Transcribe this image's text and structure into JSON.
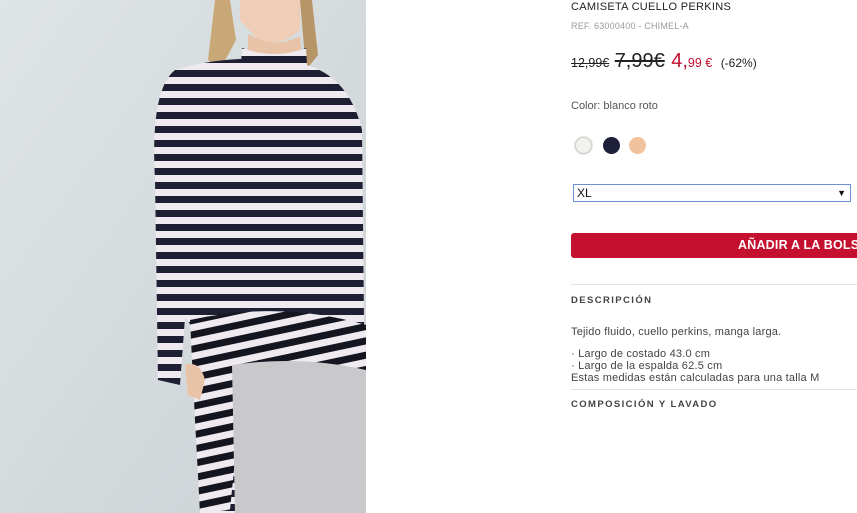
{
  "product": {
    "title": "CAMISETA CUELLO PERKINS",
    "ref": "REF. 63000400 - CHIMEL-A",
    "price_original": "12,99€",
    "price_previous": "7,99€",
    "price_current_int": "4,",
    "price_current_dec": "99 €",
    "price_discount": "(-62%)",
    "color_label": "Color: blanco roto",
    "swatches": [
      {
        "name": "blanco roto",
        "color": "#f2f2ee"
      },
      {
        "name": "navy",
        "color": "#1d2038"
      },
      {
        "name": "peach",
        "color": "#f2c29c"
      }
    ],
    "size_selected": "XL",
    "add_button": "AÑADIR A LA BOLSA",
    "description_heading": "DESCRIPCIÓN",
    "description_text": "Tejido fluido, cuello perkins, manga larga.",
    "description_list": [
      "· Largo de costado 43.0 cm",
      "· Largo de la espalda 62.5 cm",
      "Estas medidas están calculadas para una talla M"
    ],
    "composition_heading": "COMPOSICIÓN Y LAVADO"
  },
  "colors": {
    "accent": "#c4102e",
    "select_border": "#6d8fd1"
  }
}
